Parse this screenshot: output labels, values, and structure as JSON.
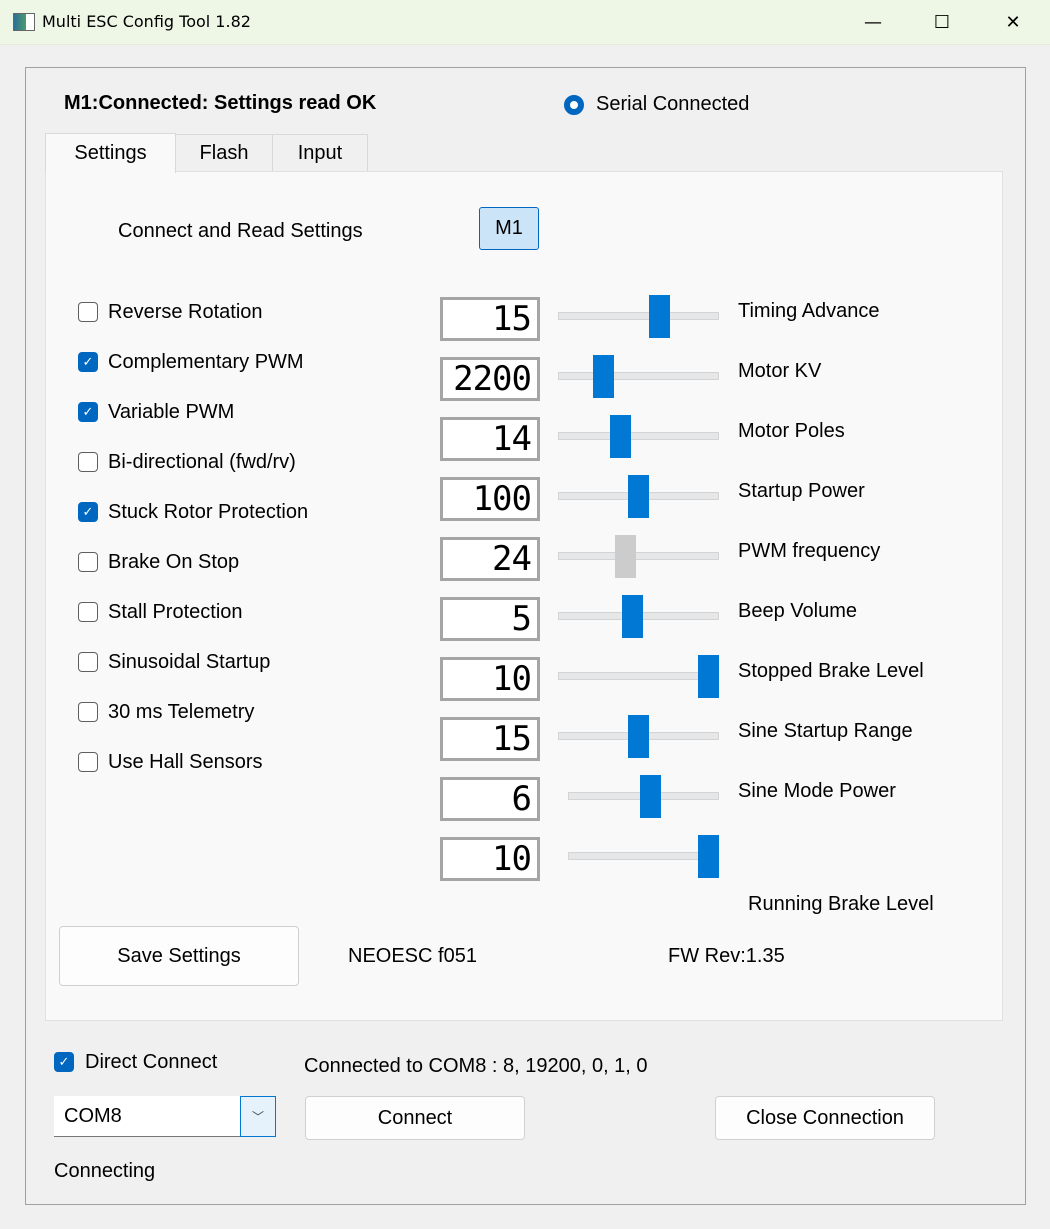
{
  "window": {
    "title": "Multi ESC Config Tool 1.82",
    "minimize": "—",
    "maximize": "☐",
    "close": "✕"
  },
  "header": {
    "status": "M1:Connected: Settings read OK",
    "serial_label": "Serial Connected",
    "serial_selected": true
  },
  "tabs": [
    {
      "label": "Settings",
      "active": true
    },
    {
      "label": "Flash"
    },
    {
      "label": "Input"
    }
  ],
  "settings": {
    "connect_read_label": "Connect and Read Settings",
    "m1_button": "M1",
    "checkboxes": [
      {
        "label": "Reverse Rotation",
        "checked": false
      },
      {
        "label": "Complementary PWM",
        "checked": true
      },
      {
        "label": "Variable PWM",
        "checked": true
      },
      {
        "label": "Bi-directional (fwd/rv)",
        "checked": false
      },
      {
        "label": "Stuck Rotor Protection",
        "checked": true
      },
      {
        "label": "Brake On Stop",
        "checked": false
      },
      {
        "label": "Stall Protection",
        "checked": false
      },
      {
        "label": "Sinusoidal Startup",
        "checked": false
      },
      {
        "label": "30 ms Telemetry",
        "checked": false
      },
      {
        "label": "Use Hall Sensors",
        "checked": false
      }
    ],
    "sliders": [
      {
        "label": "Timing Advance",
        "value": "15",
        "level": 0.65
      },
      {
        "label": "Motor KV",
        "value": "2200",
        "level": 0.25
      },
      {
        "label": "Motor Poles",
        "value": "14",
        "level": 0.37
      },
      {
        "label": "Startup Power",
        "value": "100",
        "level": 0.5
      },
      {
        "label": "PWM frequency",
        "value": "24",
        "level": 0.41,
        "disabled": true
      },
      {
        "label": "Beep Volume",
        "value": "5",
        "level": 0.46
      },
      {
        "label": "Stopped Brake Level",
        "value": "10",
        "level": 1.0
      },
      {
        "label": "Sine Startup Range",
        "value": "15",
        "level": 0.5
      },
      {
        "label": "Sine Mode Power",
        "value": "6",
        "level": 0.55
      },
      {
        "label": "Running Brake Level",
        "value": "10",
        "level": 1.0
      }
    ],
    "save_button": "Save Settings",
    "device": "NEOESC f051",
    "fw_rev": "FW Rev:1.35"
  },
  "footer": {
    "direct_connect_label": "Direct Connect",
    "direct_connect_checked": true,
    "connection_info": "Connected to COM8 : 8, 19200, 0, 1, 0",
    "port_value": "COM8",
    "connect_button": "Connect",
    "close_button": "Close Connection",
    "status": "Connecting"
  },
  "colors": {
    "accent": "#0078d4",
    "titlebar": "#eef6e6"
  }
}
